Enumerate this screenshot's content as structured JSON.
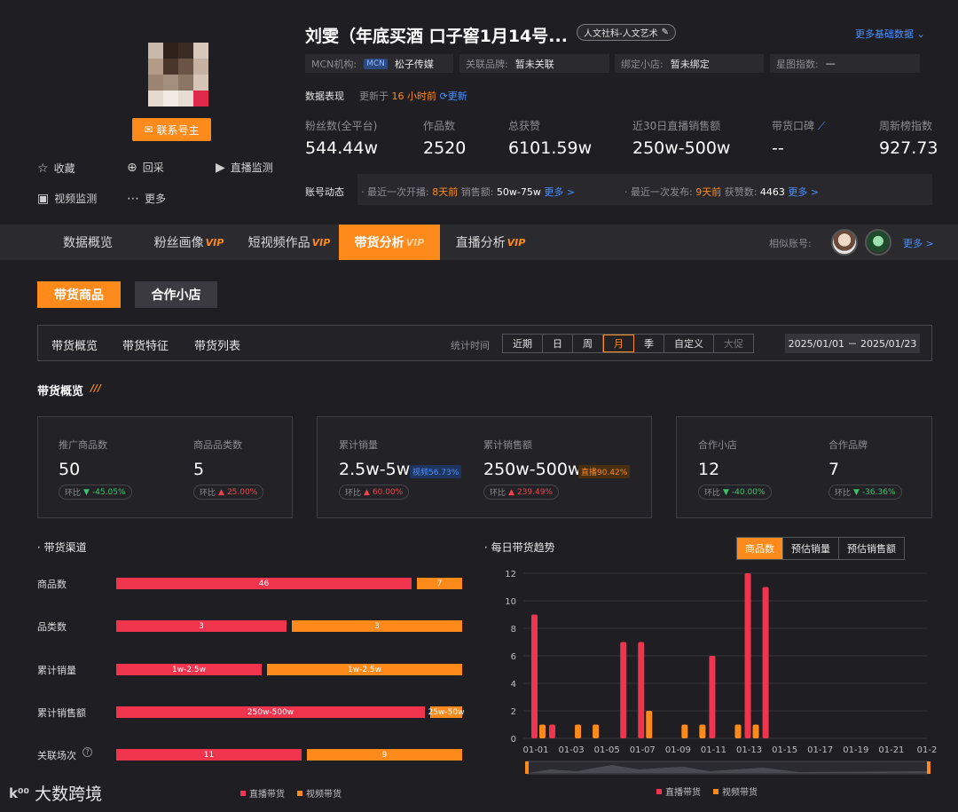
{
  "profile": {
    "name": "刘雯（年底买酒 口子窖1月14号...",
    "category_tag": "人文社科-人文艺术",
    "contact_button": "联系号主",
    "more_basic": "更多基础数据",
    "mcn_label": "MCN机构:",
    "mcn_badge": "MCN",
    "mcn_value": "松子传媒",
    "brand_label": "关联品牌:",
    "brand_value": "暂未关联",
    "shop_label": "绑定小店:",
    "shop_value": "暂未绑定",
    "star_label": "星图指数:",
    "star_value": "—",
    "actions": {
      "favorite": "收藏",
      "recollect": "回采",
      "live_monitor": "直播监测",
      "video_monitor": "视频监测",
      "more": "更多"
    }
  },
  "performance": {
    "label": "数据表现",
    "update_prefix": "更新于",
    "update_time": "16 小时前",
    "refresh": "更新",
    "stats": [
      {
        "label": "粉丝数(全平台)",
        "value": "544.44w"
      },
      {
        "label": "作品数",
        "value": "2520"
      },
      {
        "label": "总获赞",
        "value": "6101.59w"
      },
      {
        "label": "近30日直播销售额",
        "value": "250w-500w"
      },
      {
        "label": "带货口碑",
        "value": "--"
      },
      {
        "label": "周新榜指数",
        "value": "927.73"
      }
    ]
  },
  "dynamics": {
    "label": "账号动态",
    "live_prefix": "· 最近一次开播:",
    "live_days": "8天前",
    "live_sales_label": "销售额:",
    "live_sales": "50w-75w",
    "more1": "更多 >",
    "post_prefix": "· 最近一次发布:",
    "post_days": "9天前",
    "likes_label": "获赞数:",
    "likes": "4463",
    "more2": "更多 >"
  },
  "tabs": [
    {
      "label": "数据概览",
      "vip": ""
    },
    {
      "label": "粉丝画像",
      "vip": "VIP"
    },
    {
      "label": "短视频作品",
      "vip": "VIP"
    },
    {
      "label": "带货分析",
      "vip": "VIP"
    },
    {
      "label": "直播分析",
      "vip": "VIP"
    }
  ],
  "similar": {
    "label": "相似账号:",
    "more": "更多 >"
  },
  "subtabs": {
    "products": "带货商品",
    "shops": "合作小店"
  },
  "filter": {
    "tabs": [
      "带货概览",
      "带货特征",
      "带货列表"
    ],
    "time_label": "统计时间",
    "periods": [
      "近期",
      "日",
      "周",
      "月",
      "季",
      "自定义",
      "大促"
    ],
    "active_period": "月",
    "date_range": "2025/01/01 － 2025/01/23"
  },
  "overview": {
    "title": "带货概览",
    "deco": "///",
    "metrics": {
      "promo_count": {
        "label": "推广商品数",
        "value": "50",
        "chg_label": "环比",
        "chg": "-45.05%",
        "dir": "down"
      },
      "categories": {
        "label": "商品品类数",
        "value": "5",
        "chg_label": "环比",
        "chg": "25.00%",
        "dir": "up"
      },
      "sales_volume": {
        "label": "累计销量",
        "value": "2.5w-5w",
        "badge": "视频56.73%",
        "chg_label": "环比",
        "chg": "60.00%",
        "dir": "up"
      },
      "sales_amount": {
        "label": "累计销售额",
        "value": "250w-500w",
        "badge": "直播90.42%",
        "chg_label": "环比",
        "chg": "239.49%",
        "dir": "up"
      },
      "partner_shops": {
        "label": "合作小店",
        "value": "12",
        "chg_label": "环比",
        "chg": "-40.00%",
        "dir": "down"
      },
      "partner_brands": {
        "label": "合作品牌",
        "value": "7",
        "chg_label": "环比",
        "chg": "-36.36%",
        "dir": "down"
      }
    }
  },
  "channel": {
    "title": "· 带货渠道",
    "rows": [
      {
        "label": "商品数",
        "live": "46",
        "video": "7",
        "live_frac": 0.868
      },
      {
        "label": "品类数",
        "live": "3",
        "video": "3",
        "live_frac": 0.5
      },
      {
        "label": "累计销量",
        "live": "1w-2.5w",
        "video": "1w-2.5w",
        "live_frac": 0.427
      },
      {
        "label": "累计销售额",
        "live": "250w-500w",
        "video": "25w-50w",
        "live_frac": 0.905
      },
      {
        "label": "关联场次",
        "live": "11",
        "video": "9",
        "live_frac": 0.545
      }
    ],
    "legend_live": "直播带货",
    "legend_video": "视频带货"
  },
  "trend": {
    "title": "· 每日带货趋势",
    "toggle": [
      "商品数",
      "预估销量",
      "预估销售额"
    ],
    "active": "商品数"
  },
  "chart_data": {
    "type": "bar",
    "title": "",
    "x": [
      "01-01",
      "01-02",
      "01-03",
      "01-04",
      "01-05",
      "01-06",
      "01-07",
      "01-08",
      "01-09",
      "01-10",
      "01-11",
      "01-12",
      "01-13",
      "01-14",
      "01-15",
      "01-16",
      "01-17",
      "01-18",
      "01-19",
      "01-20",
      "01-21",
      "01-22",
      "01-23"
    ],
    "xtick_labels": [
      "01-01",
      "01-03",
      "01-05",
      "01-07",
      "01-09",
      "01-11",
      "01-13",
      "01-15",
      "01-17",
      "01-19",
      "01-21",
      "01-2"
    ],
    "series": [
      {
        "name": "直播带货",
        "color": "#f0344d",
        "values": [
          9,
          1,
          0,
          0,
          0,
          7,
          7,
          0,
          0,
          0,
          6,
          0,
          12,
          11,
          0,
          0,
          0,
          0,
          0,
          0,
          0,
          0,
          0
        ]
      },
      {
        "name": "视频带货",
        "color": "#ff8a1c",
        "values": [
          1,
          0,
          1,
          1,
          0,
          0,
          2,
          0,
          1,
          1,
          0,
          1,
          1,
          0,
          0,
          0,
          0,
          0,
          0,
          0,
          0,
          0,
          0
        ]
      }
    ],
    "ylim": [
      0,
      12
    ],
    "yticks": [
      0,
      2,
      4,
      6,
      8,
      10,
      12
    ],
    "grid": true,
    "legend": "bottom"
  },
  "colors": {
    "accent": "#ff8a1c",
    "live": "#f0344d",
    "link": "#4a90ff"
  },
  "footer": {
    "logo_mark": "k⁰⁰",
    "logo_text": "大数跨境"
  }
}
